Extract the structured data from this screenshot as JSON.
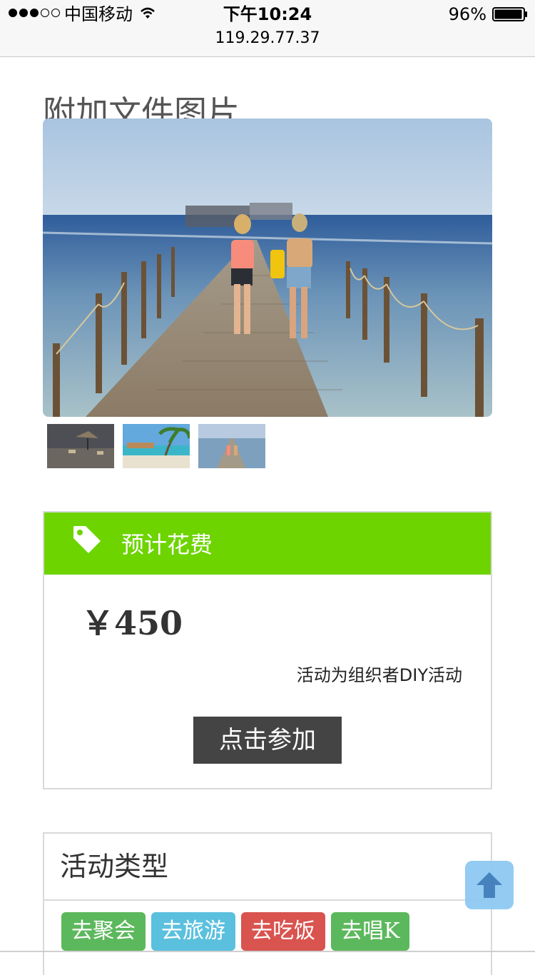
{
  "status_bar": {
    "carrier": "中国移动",
    "time": "下午10:24",
    "url": "119.29.77.37",
    "battery_percent": "96%",
    "signal_filled": 3,
    "signal_total": 5,
    "icons": [
      "wifi-icon",
      "battery-icon"
    ]
  },
  "attachments": {
    "title": "附加文件图片",
    "main_image": "boardwalk-pier-photo",
    "thumbnails": [
      "beach-hut-thumbnail",
      "palm-resort-thumbnail",
      "pier-thumbnail"
    ]
  },
  "cost": {
    "header_label": "预计花费",
    "icon": "tag-icon",
    "amount": "￥450",
    "note": "活动为组织者DIY活动",
    "join_button": "点击参加",
    "header_color": "#6dd400",
    "button_color": "#444444"
  },
  "activity_type": {
    "title": "活动类型",
    "tags": [
      {
        "label": "去聚会",
        "color": "#5cb85c"
      },
      {
        "label": "去旅游",
        "color": "#5bc0de"
      },
      {
        "label": "去吃饭",
        "color": "#d9534f"
      },
      {
        "label": "去唱K",
        "color": "#5cb85c"
      }
    ]
  },
  "back_to_top": {
    "icon": "arrow-up-icon",
    "color": "#8ec9f2"
  }
}
